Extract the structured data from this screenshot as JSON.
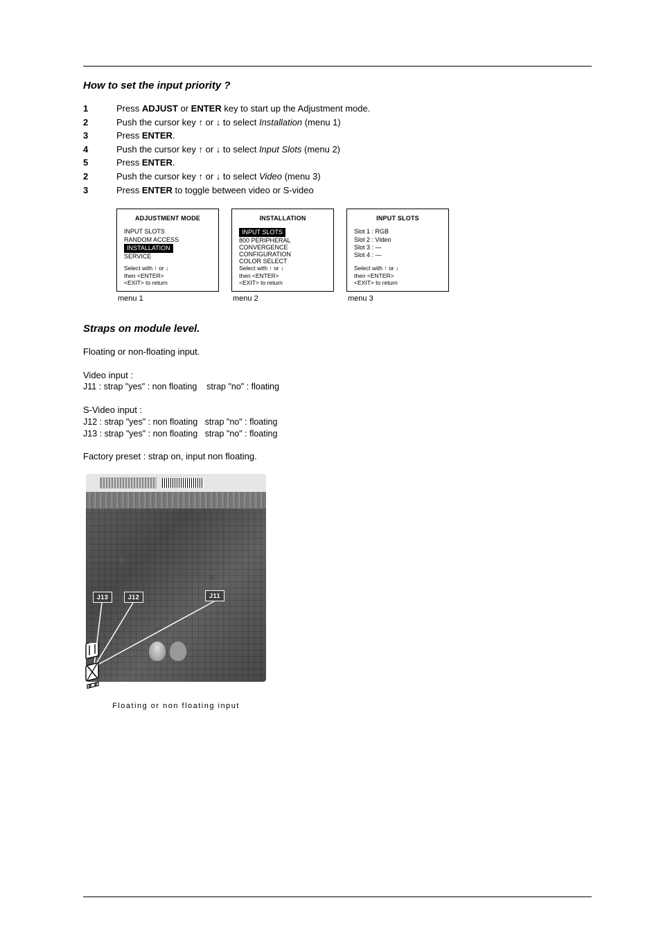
{
  "section1_title": "How to set the input priority ?",
  "steps": [
    {
      "n": "1",
      "pre": "Press ",
      "b1": "ADJUST",
      "mid": " or ",
      "b2": "ENTER",
      "post": " key to start up the Adjustment mode."
    },
    {
      "n": "2",
      "pre": "Push the cursor key ",
      "a1": "↑",
      "mid": " or ",
      "a2": "↓",
      "post1": " to select ",
      "it": "Installation",
      "post2": " (menu 1)"
    },
    {
      "n": "3",
      "pre": "Press ",
      "b1": "ENTER",
      "post": "."
    },
    {
      "n": "4",
      "pre": "Push the cursor key ",
      "a1": "↑",
      "mid": " or ",
      "a2": "↓",
      "post1": " to select ",
      "it": "Input Slots",
      "post2": " (menu 2)"
    },
    {
      "n": "5",
      "pre": "Press ",
      "b1": "ENTER",
      "post": "."
    },
    {
      "n": "2",
      "pre": "Push the cursor key ",
      "a1": "↑",
      "mid": " or ",
      "a2": "↓",
      "post1": " to select ",
      "it": "Video",
      "post2": " (menu 3)"
    },
    {
      "n": "3",
      "pre": "Press ",
      "b1": "ENTER",
      "post": " to toggle between video or S-video"
    }
  ],
  "menu1": {
    "label": "menu 1",
    "title": "ADJUSTMENT MODE",
    "lines": [
      "INPUT SLOTS",
      "RANDOM ACCESS"
    ],
    "hl": "INSTALLATION",
    "lines2": [
      "SERVICE"
    ],
    "footer": "Select with ↑ or ↓\nthen <ENTER>\n<EXIT> to return"
  },
  "menu2": {
    "label": "menu 2",
    "title": "INSTALLATION",
    "hl": "INPUT SLOTS",
    "lines": [
      "800 PERIPHERAL",
      "CONVERGENCE",
      "CONFIGURATION",
      "COLOR SELECT"
    ],
    "footer": "Select with ↑ or ↓\nthen <ENTER>\n<EXIT> to return"
  },
  "menu3": {
    "label": "menu 3",
    "title": "INPUT SLOTS",
    "lines": [
      "Slot 1 : RGB",
      "Slot 2 : Video",
      "Slot 3 : —",
      "Slot 4 : —"
    ],
    "footer": "Select with ↑ or ↓\nthen <ENTER>\n<EXIT> to return"
  },
  "section2_title": "Straps on module level.",
  "p_floating": "Floating or non-floating input.",
  "p_video_head": "Video input :",
  "p_video_line": "J11 : strap \"yes\" : non floating    strap \"no\" : floating",
  "p_svideo_head": "S-Video input :",
  "p_svideo_l1": "J12 : strap \"yes\" : non floating   strap \"no\" : floating",
  "p_svideo_l2": "J13 : strap \"yes\" : non floating   strap \"no\" : floating",
  "p_factory": "Factory preset : strap on, input non floating.",
  "j_labels": {
    "j13": "J13",
    "j12": "J12",
    "j11": "J11"
  },
  "pcb_caption": "Floating or non floating input"
}
